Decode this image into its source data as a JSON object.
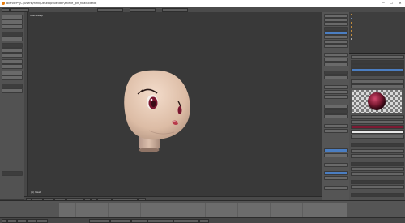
{
  "window": {
    "title": "Blender* [C:\\Users\\mmk\\Desktop\\Blender\\anime_girl_head.blend]",
    "minimize": "—",
    "maximize": "☐",
    "close": "✕"
  },
  "viewport": {
    "label": "User Persp",
    "object_label": "(1) Head"
  },
  "colors": {
    "accent": "#4b7ec2",
    "viewport_bg": "#393939",
    "panel_bg": "#555555",
    "skin": "#e8cab3",
    "iris": "#7a1630",
    "material_ball": "#7c1a33"
  }
}
